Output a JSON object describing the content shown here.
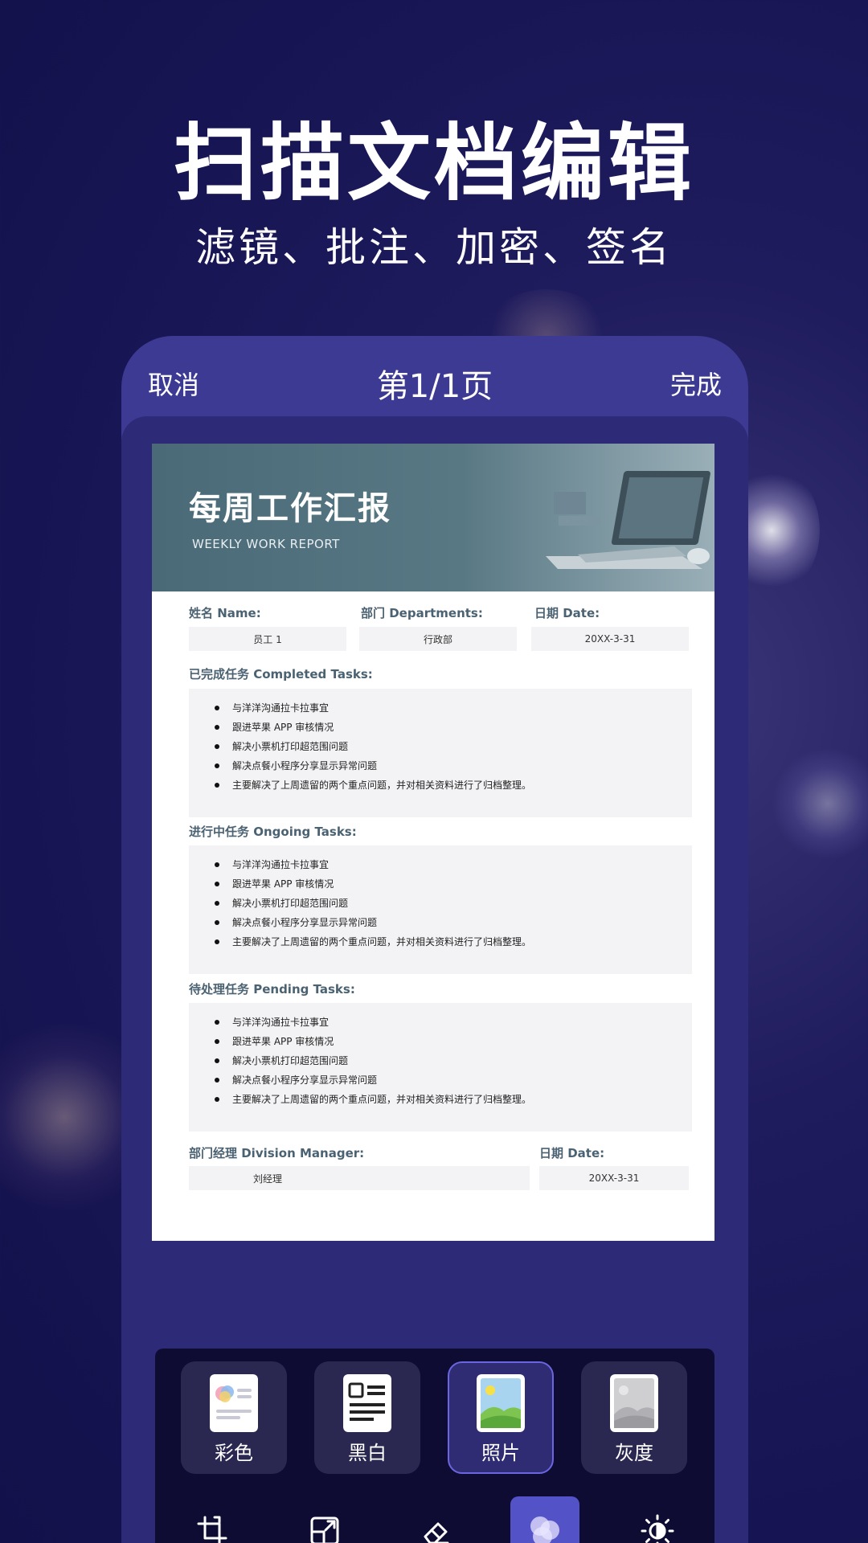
{
  "hero": {
    "title": "扫描文档编辑",
    "subtitle": "滤镜、批注、加密、签名"
  },
  "header": {
    "cancel": "取消",
    "page_indicator": "第1/1页",
    "done": "完成"
  },
  "document": {
    "title": "每周工作汇报",
    "subtitle_en": "WEEKLY WORK REPORT",
    "name_label": "姓名 Name:",
    "name_value": "员工 1",
    "dept_label": "部门 Departments:",
    "dept_value": "行政部",
    "date_label": "日期 Date:",
    "date_value": "20XX-3-31",
    "completed": {
      "title": "已完成任务 Completed Tasks:",
      "items": [
        "与洋洋沟通拉卡拉事宜",
        "跟进苹果 APP 审核情况",
        "解决小票机打印超范围问题",
        "解决点餐小程序分享显示异常问题",
        "主要解决了上周遗留的两个重点问题，并对相关资料进行了归档整理。"
      ]
    },
    "ongoing": {
      "title": "进行中任务 Ongoing Tasks:",
      "items": [
        "与洋洋沟通拉卡拉事宜",
        "跟进苹果 APP 审核情况",
        "解决小票机打印超范围问题",
        "解决点餐小程序分享显示异常问题",
        "主要解决了上周遗留的两个重点问题，并对相关资料进行了归档整理。"
      ]
    },
    "pending": {
      "title": "待处理任务 Pending Tasks:",
      "items": [
        "与洋洋沟通拉卡拉事宜",
        "跟进苹果 APP 审核情况",
        "解决小票机打印超范围问题",
        "解决点餐小程序分享显示异常问题",
        "主要解决了上周遗留的两个重点问题，并对相关资料进行了归档整理。"
      ]
    },
    "manager_label": "部门经理 Division Manager:",
    "manager_value": "刘经理",
    "manager_date_label": "日期 Date:",
    "manager_date_value": "20XX-3-31"
  },
  "filters": {
    "selected": "照片",
    "options": [
      {
        "label": "彩色",
        "icon": "color-doc-icon"
      },
      {
        "label": "黑白",
        "icon": "bw-doc-icon"
      },
      {
        "label": "照片",
        "icon": "photo-icon"
      },
      {
        "label": "灰度",
        "icon": "grayscale-icon"
      }
    ]
  },
  "tools": {
    "items": [
      "crop-icon",
      "resize-icon",
      "eraser-icon",
      "filter-icon",
      "brightness-icon"
    ],
    "active": "filter-icon"
  },
  "colors": {
    "background": "#1a1856",
    "phone_frame": "#3d3a93",
    "panel": "#0e0c33",
    "accent": "#5452c7",
    "doc_banner": "#4f6f7c",
    "doc_label": "#4b6272"
  }
}
